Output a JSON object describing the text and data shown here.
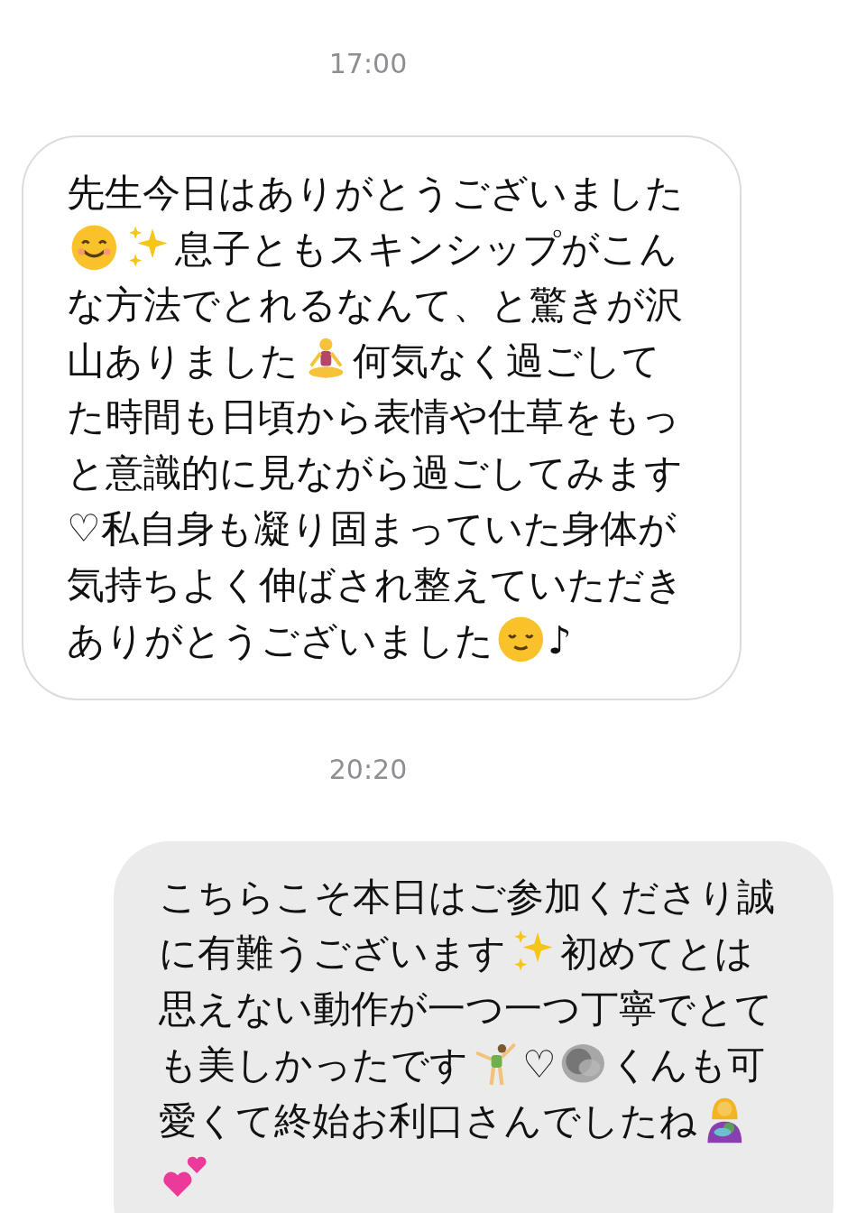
{
  "messages": [
    {
      "time": "17:00",
      "sent": false,
      "lines": [
        [
          {
            "kind": "text",
            "text": "先生今日はありがとうございました"
          }
        ],
        [
          {
            "kind": "smiling-face"
          },
          {
            "kind": "sparkles"
          },
          {
            "kind": "text",
            "text": "息子ともスキンシップがこん"
          }
        ],
        [
          {
            "kind": "text",
            "text": "な方法でとれるなんて、と驚きが沢"
          }
        ],
        [
          {
            "kind": "text",
            "text": "山ありました"
          },
          {
            "kind": "meditating-figure"
          },
          {
            "kind": "text",
            "text": "何気なく過ごして"
          }
        ],
        [
          {
            "kind": "text",
            "text": "た時間も日頃から表情や仕草をもっ"
          }
        ],
        [
          {
            "kind": "text",
            "text": "と意識的に見ながら過ごしてみます"
          }
        ],
        [
          {
            "kind": "text",
            "text": "♡私自身も凝り固まっていた身体が"
          }
        ],
        [
          {
            "kind": "text",
            "text": "気持ちよく伸ばされ整えていただき"
          }
        ],
        [
          {
            "kind": "text",
            "text": "ありがとうございました"
          },
          {
            "kind": "relieved-face"
          },
          {
            "kind": "text",
            "text": "♪"
          }
        ]
      ]
    },
    {
      "time": "20:20",
      "sent": true,
      "lines": [
        [
          {
            "kind": "text",
            "text": "こちらこそ本日はご参加くださり誠"
          }
        ],
        [
          {
            "kind": "text",
            "text": "に有難うございます"
          },
          {
            "kind": "sparkles"
          },
          {
            "kind": "text",
            "text": "初めてとは"
          }
        ],
        [
          {
            "kind": "text",
            "text": "思えない動作が一つ一つ丁寧でとて"
          }
        ],
        [
          {
            "kind": "text",
            "text": "も美しかったです"
          },
          {
            "kind": "cartwheel-figure"
          },
          {
            "kind": "text",
            "text": "♡"
          },
          {
            "kind": "redacted"
          },
          {
            "kind": "text",
            "text": "くんも可"
          }
        ],
        [
          {
            "kind": "text",
            "text": "愛くて終始お利口さんでしたね"
          },
          {
            "kind": "mother-figure"
          }
        ],
        [
          {
            "kind": "hearts"
          }
        ]
      ]
    }
  ]
}
